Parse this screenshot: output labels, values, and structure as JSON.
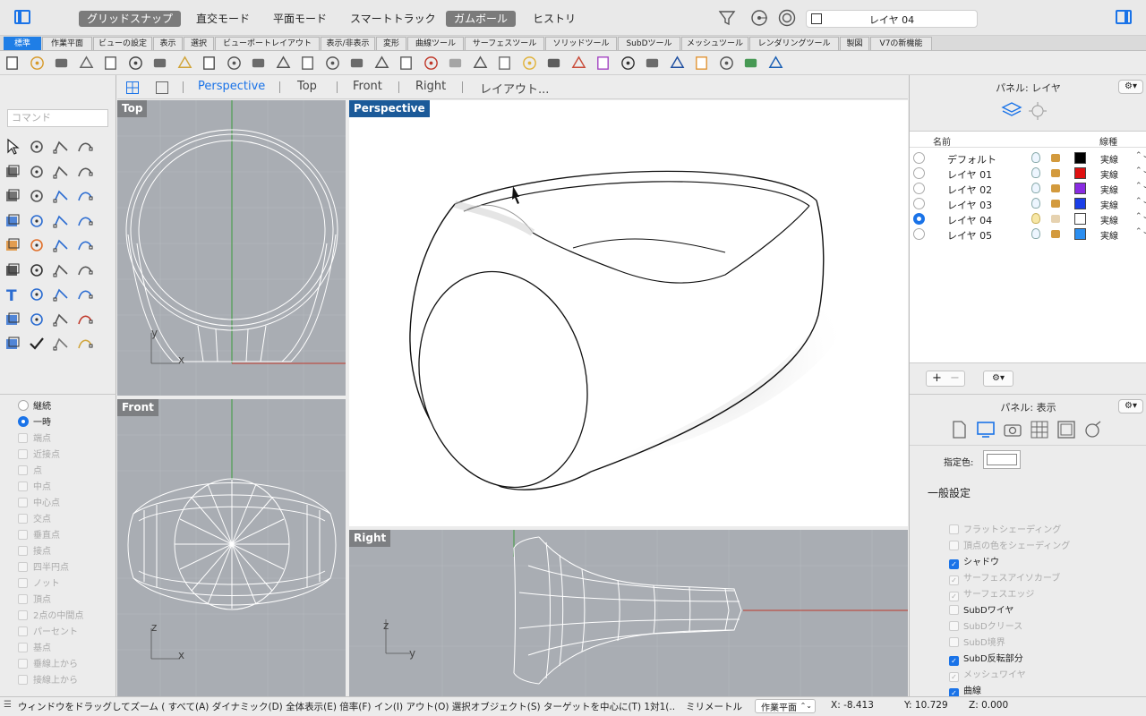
{
  "titlebar": {
    "modes": [
      {
        "label": "グリッドスナップ",
        "active": true
      },
      {
        "label": "直交モード",
        "active": false
      },
      {
        "label": "平面モード",
        "active": false
      },
      {
        "label": "スマートトラック",
        "active": false
      },
      {
        "label": "ガムボール",
        "active": true
      },
      {
        "label": "ヒストリ",
        "active": false
      }
    ],
    "current_layer": "レイヤ 04"
  },
  "tabs": [
    "標準",
    "作業平面",
    "ビューの設定",
    "表示",
    "選択",
    "ビューポートレイアウト",
    "表示/非表示",
    "変形",
    "曲線ツール",
    "サーフェスツール",
    "ソリッドツール",
    "SubDツール",
    "メッシュツール",
    "レンダリングツール",
    "製図",
    "V7の新機能"
  ],
  "command_placeholder": "コマンド",
  "viewport_tabs": [
    "Perspective",
    "Top",
    "Front",
    "Right",
    "レイアウト..."
  ],
  "viewports": {
    "top": "Top",
    "front": "Front",
    "perspective": "Perspective",
    "right": "Right"
  },
  "axes": {
    "x": "x",
    "y": "y",
    "z": "z"
  },
  "osnap": {
    "modes": [
      {
        "label": "継続",
        "selected": false
      },
      {
        "label": "一時",
        "selected": true
      }
    ],
    "items": [
      "端点",
      "近接点",
      "点",
      "中点",
      "中心点",
      "交点",
      "垂直点",
      "接点",
      "四半円点",
      "ノット",
      "頂点",
      "2点の中間点",
      "パーセント",
      "基点",
      "垂線上から",
      "接線上から"
    ]
  },
  "layer_panel": {
    "title": "パネル: レイヤ",
    "col_name": "名前",
    "col_linetype": "線種",
    "layers": [
      {
        "name": "デフォルト",
        "color": "#000000",
        "linetype": "実線",
        "current": false
      },
      {
        "name": "レイヤ 01",
        "color": "#e01010",
        "linetype": "実線",
        "current": false
      },
      {
        "name": "レイヤ 02",
        "color": "#8a2be2",
        "linetype": "実線",
        "current": false
      },
      {
        "name": "レイヤ 03",
        "color": "#1a3ee8",
        "linetype": "実線",
        "current": false
      },
      {
        "name": "レイヤ 04",
        "color": "#ffffff",
        "linetype": "実線",
        "current": true
      },
      {
        "name": "レイヤ 05",
        "color": "#2b8ef0",
        "linetype": "実線",
        "current": false
      }
    ],
    "add": "+",
    "remove": "−"
  },
  "display_panel": {
    "title": "パネル: 表示",
    "color_label": "指定色:",
    "section": "一般設定",
    "options": [
      {
        "label": "フラットシェーディング",
        "checked": false,
        "enabled": false
      },
      {
        "label": "頂点の色をシェーディング",
        "checked": false,
        "enabled": false
      },
      {
        "label": "シャドウ",
        "checked": true,
        "enabled": true
      },
      {
        "label": "サーフェスアイソカーブ",
        "checked": true,
        "enabled": false
      },
      {
        "label": "サーフェスエッジ",
        "checked": true,
        "enabled": false
      },
      {
        "label": "SubDワイヤ",
        "checked": false,
        "enabled": true
      },
      {
        "label": "SubDクリース",
        "checked": false,
        "enabled": false
      },
      {
        "label": "SubD境界",
        "checked": false,
        "enabled": false
      },
      {
        "label": "SubD反転部分",
        "checked": true,
        "enabled": true
      },
      {
        "label": "メッシュワイヤ",
        "checked": true,
        "enabled": false
      },
      {
        "label": "曲線",
        "checked": true,
        "enabled": true
      }
    ]
  },
  "status": {
    "message": "ウィンドウをドラッグしてズーム ( すべて(A) ダイナミック(D) 全体表示(E) 倍率(F) イン(I) アウト(O) 選択オブジェクト(S) ターゲットを中心に(T) 1対1(...",
    "units": "ミリメートル",
    "cplane": "作業平面",
    "x": "X: -8.413",
    "y": "Y: 10.729",
    "z": "Z: 0.000"
  }
}
